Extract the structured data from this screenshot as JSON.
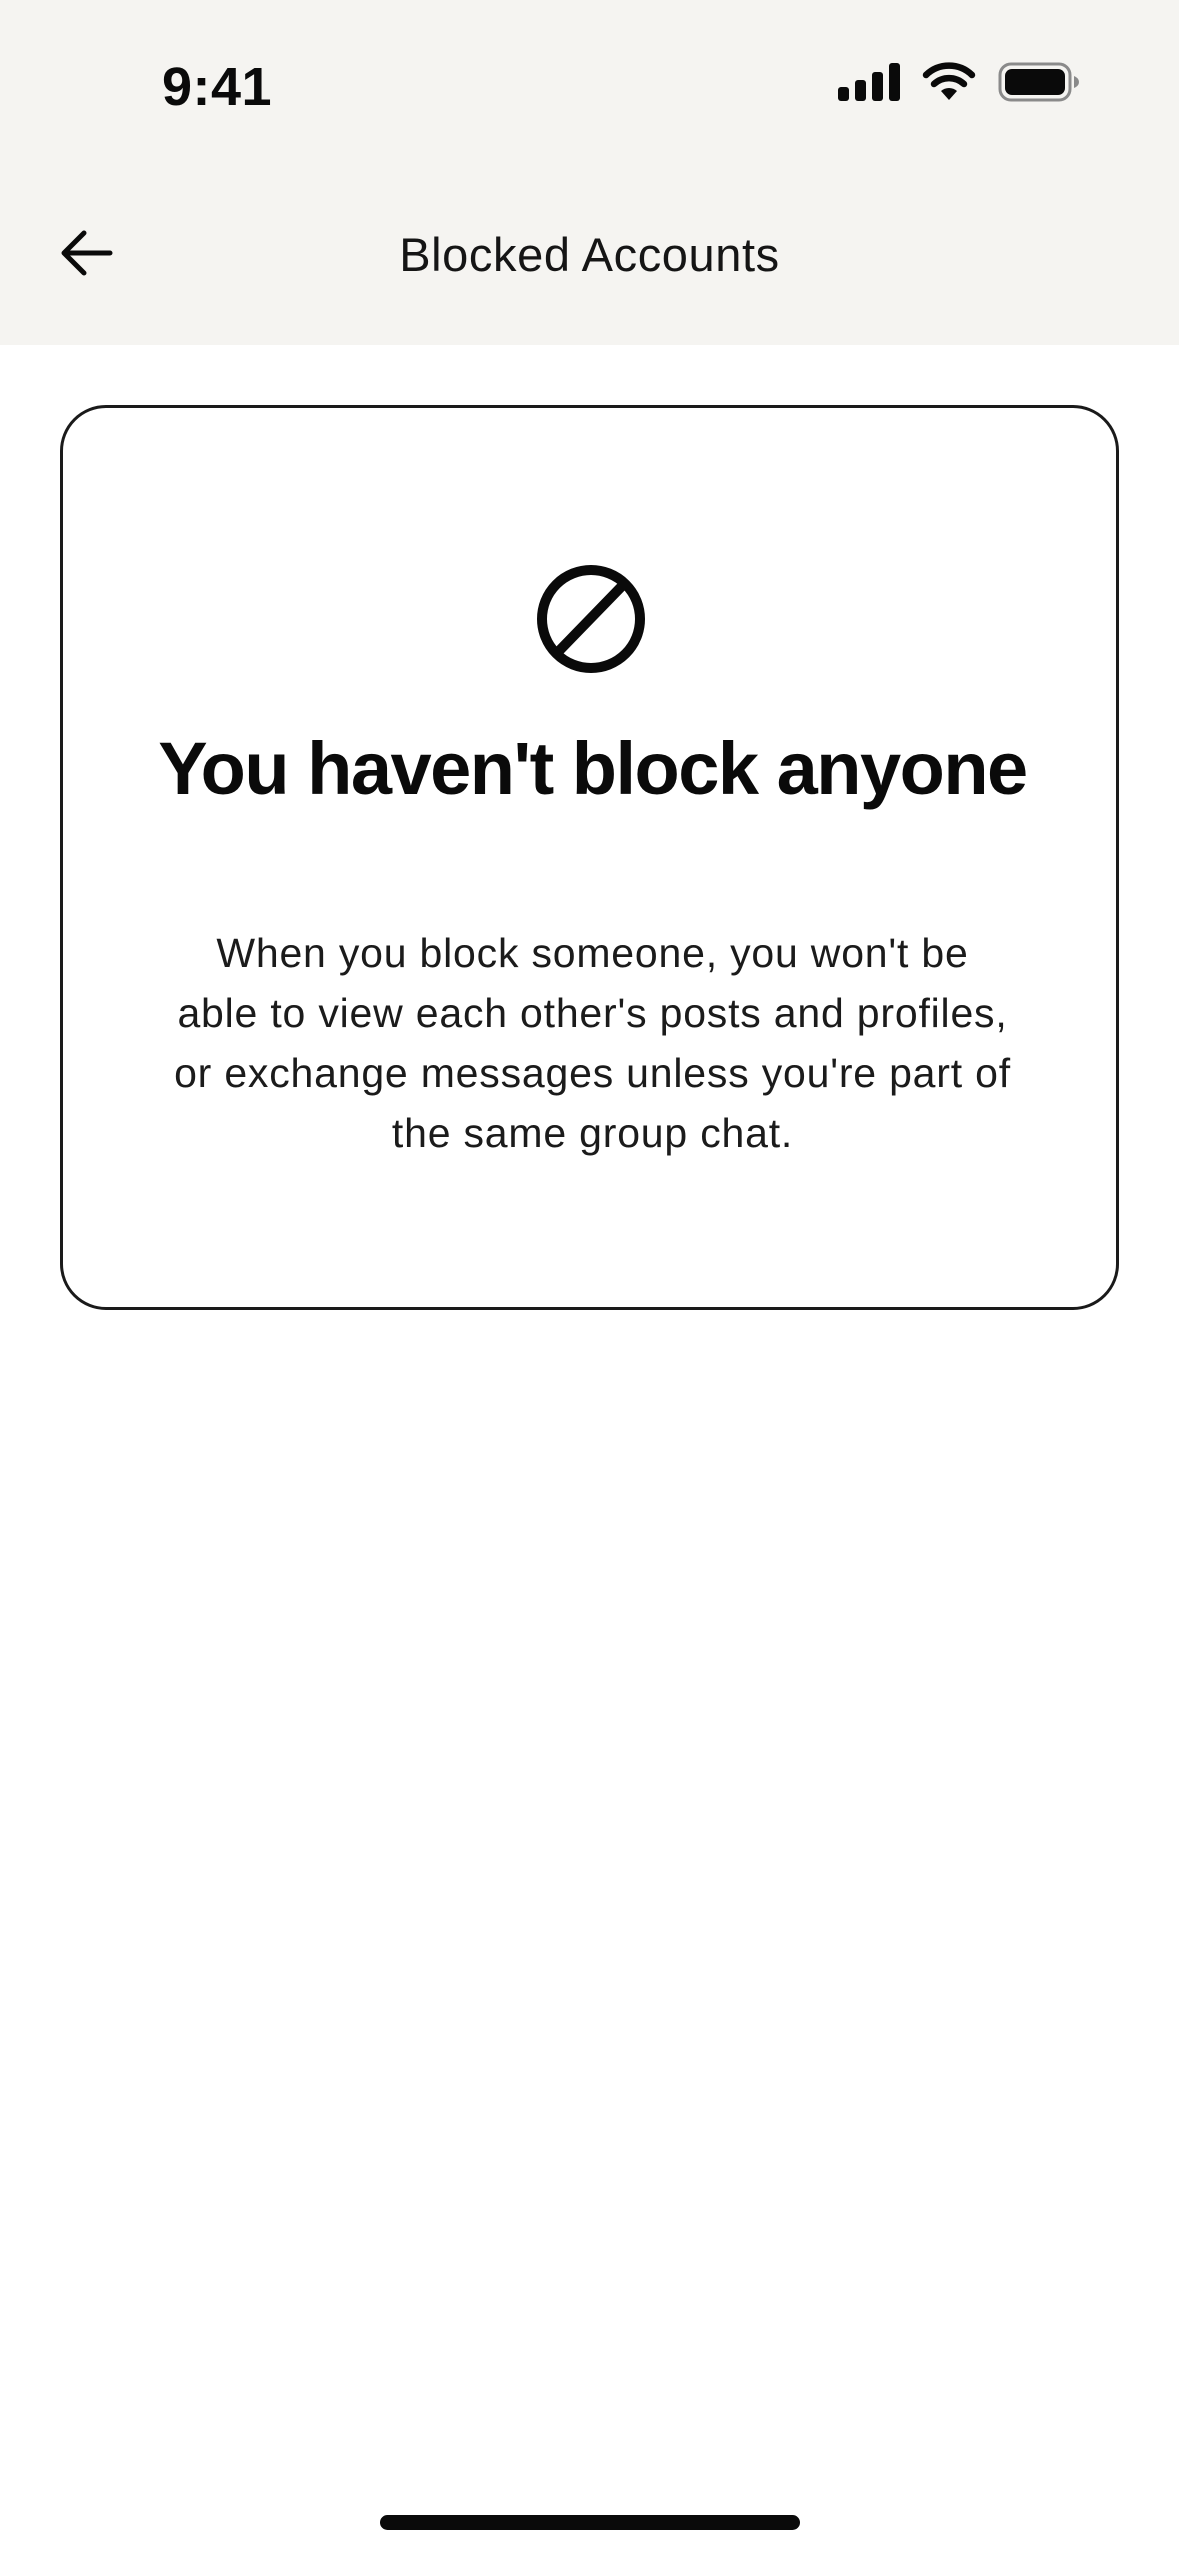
{
  "status_bar": {
    "time": "9:41",
    "icons": [
      "cellular-signal-icon",
      "wifi-icon",
      "battery-icon"
    ]
  },
  "nav": {
    "title": "Blocked Accounts",
    "back_icon": "arrow-left-icon"
  },
  "empty_state": {
    "icon": "block-icon",
    "title": "You haven't block anyone",
    "description": "When you block someone, you won't be able to view each other's posts and profiles, or exchange messages unless you're part of the same group chat."
  },
  "colors": {
    "header_background": "#f5f4f1",
    "page_background": "#ffffff",
    "text_primary": "#0a0a0a",
    "card_border": "#1a1a1a"
  }
}
